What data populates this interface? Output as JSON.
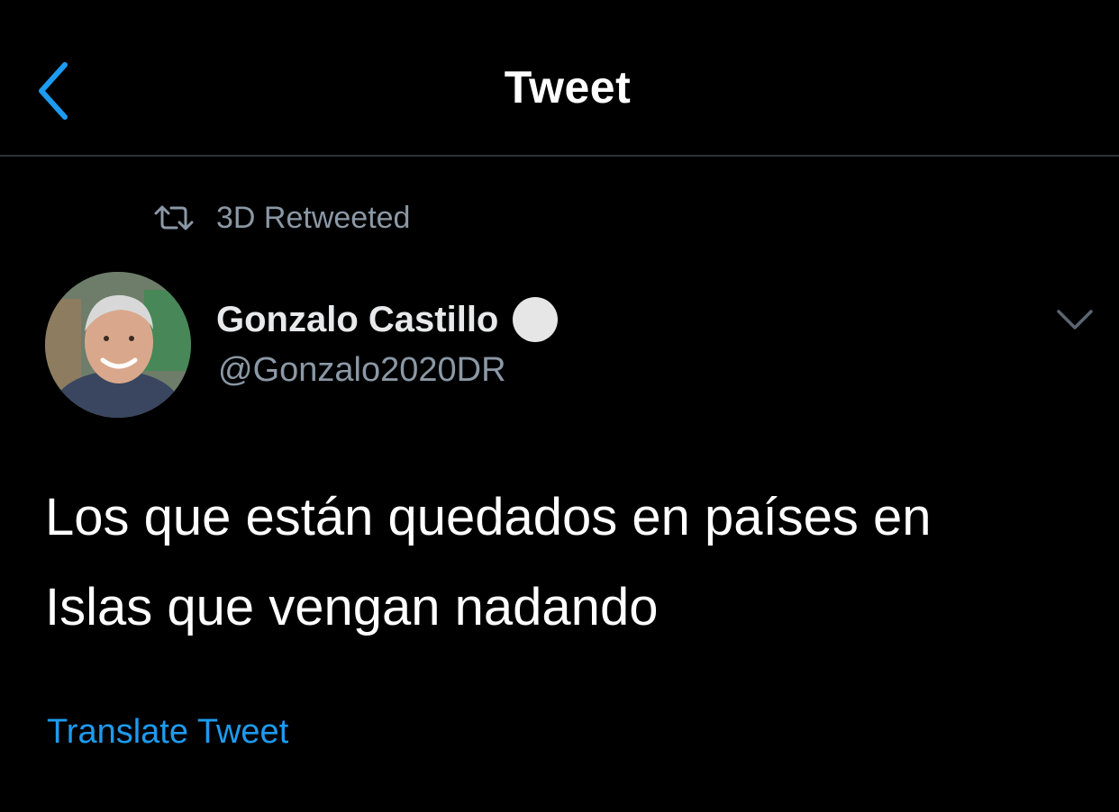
{
  "header": {
    "title": "Tweet",
    "back_icon": "chevron-left-icon"
  },
  "retweet_context": {
    "label": "3D Retweeted",
    "icon": "retweet-icon"
  },
  "tweet": {
    "author_name": "Gonzalo Castillo",
    "handle": "@Gonzalo2020DR",
    "verified_badge": "verified-icon",
    "text_line_1": "Los que están quedados en países en",
    "text_line_2": "Islas que vengan nadando",
    "translate_label": "Translate Tweet",
    "more_icon": "chevron-down-icon"
  },
  "colors": {
    "background": "#000000",
    "accent": "#1d9bf0",
    "secondary_text": "#8b98a5",
    "divider": "#2f3336"
  }
}
